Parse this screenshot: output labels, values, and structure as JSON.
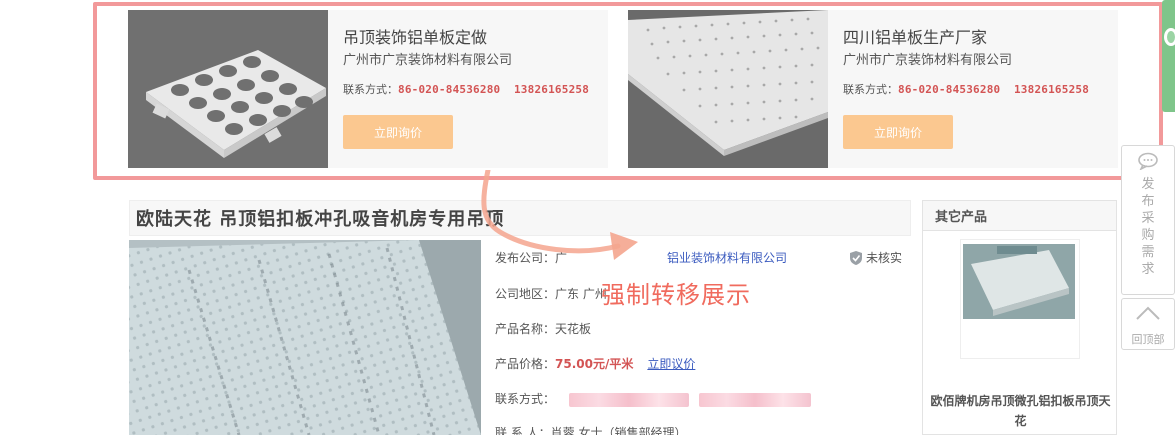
{
  "ads": [
    {
      "title": "吊顶装饰铝单板定做",
      "company": "广州市广京装饰材料有限公司",
      "contact_label": "联系方式：",
      "contact_numbers": "86-020-84536280  13826165258",
      "button": "立即询价"
    },
    {
      "title": "四川铝单板生产厂家",
      "company": "广州市广京装饰材料有限公司",
      "contact_label": "联系方式：",
      "contact_numbers": "86-020-84536280  13826165258",
      "button": "立即询价"
    }
  ],
  "float": {
    "post_label": "发布采购需求",
    "back_top": "回顶部"
  },
  "product": {
    "title": "欧陆天花 吊顶铝扣板冲孔吸音机房专用吊顶",
    "publisher_label": "发布公司：",
    "publisher_partial": "广",
    "publisher_value": "铝业装饰材料有限公司",
    "verify_status": "未核实",
    "region_label": "公司地区：",
    "region_value": "广东 广州",
    "name_label": "产品名称：",
    "name_value": "天花板",
    "price_label": "产品价格：",
    "price_value": "75.00元/平米",
    "quote_link": "立即议价",
    "contact_label": "联系方式：",
    "contact_person_label": "联 系 人：",
    "contact_person_value": "肖蓉 女士（销售部经理）"
  },
  "annotation": {
    "text": "强制转移展示",
    "color": "#f06b5e"
  },
  "sidebar": {
    "heading": "其它产品",
    "item_name": "欧佰牌机房吊顶微孔铝扣板吊顶天花"
  },
  "colors": {
    "highlight_border": "#f2999a",
    "button_bg": "#fbc890",
    "price_red": "#d35454",
    "link_blue": "#3b5bbf"
  }
}
